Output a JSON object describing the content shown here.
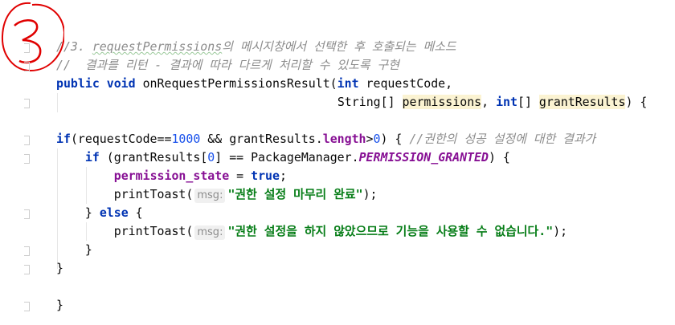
{
  "annotation": {
    "label": "3",
    "color": "#e00000"
  },
  "code_lines": [
    {
      "indent": 0,
      "tokens": [
        {
          "t": "//3. ",
          "c": "cm"
        },
        {
          "t": "requestPermissions",
          "c": "cm wavy"
        },
        {
          "t": "의 메시지창에서 선택한 후 호출되는 메소드",
          "c": "cm"
        }
      ]
    },
    {
      "indent": 0,
      "tokens": [
        {
          "t": "//  결과를 리턴 - 결과에 따라 다르게 처리할 수 있도록 구현",
          "c": "cm"
        }
      ]
    },
    {
      "indent": 0,
      "tokens": [
        {
          "t": "public void ",
          "c": "kw"
        },
        {
          "t": "onRequestPermissionsResult(",
          "c": ""
        },
        {
          "t": "int ",
          "c": "kw"
        },
        {
          "t": "requestCode,",
          "c": ""
        }
      ]
    },
    {
      "indent": 39,
      "tokens": [
        {
          "t": "String[] ",
          "c": ""
        },
        {
          "t": "permissions",
          "c": "hl"
        },
        {
          "t": ", ",
          "c": ""
        },
        {
          "t": "int",
          "c": "kw"
        },
        {
          "t": "[] ",
          "c": ""
        },
        {
          "t": "grantResults",
          "c": "hl"
        },
        {
          "t": ") {",
          "c": ""
        }
      ]
    },
    {
      "indent": 0,
      "tokens": []
    },
    {
      "indent": 0,
      "tokens": [
        {
          "t": "if",
          "c": "kw"
        },
        {
          "t": "(requestCode==",
          "c": ""
        },
        {
          "t": "1000",
          "c": "num"
        },
        {
          "t": " && grantResults.",
          "c": ""
        },
        {
          "t": "length",
          "c": "fld"
        },
        {
          "t": ">",
          "c": ""
        },
        {
          "t": "0",
          "c": "num"
        },
        {
          "t": ") { ",
          "c": ""
        },
        {
          "t": "//권한의 성공 설정에 대한 결과가",
          "c": "cm"
        }
      ]
    },
    {
      "indent": 4,
      "tokens": [
        {
          "t": "if ",
          "c": "kw"
        },
        {
          "t": "(grantResults[",
          "c": ""
        },
        {
          "t": "0",
          "c": "num"
        },
        {
          "t": "] == PackageManager.",
          "c": ""
        },
        {
          "t": "PERMISSION_GRANTED",
          "c": "cst"
        },
        {
          "t": ") {",
          "c": ""
        }
      ]
    },
    {
      "indent": 8,
      "tokens": [
        {
          "t": "permission_state",
          "c": "fld"
        },
        {
          "t": " = ",
          "c": ""
        },
        {
          "t": "true",
          "c": "kw"
        },
        {
          "t": ";",
          "c": ""
        }
      ]
    },
    {
      "indent": 8,
      "tokens": [
        {
          "t": "printToast(",
          "c": ""
        },
        {
          "t": "msg:",
          "c": "hint"
        },
        {
          "t": "\"권한 설정 마무리 완료\"",
          "c": "str"
        },
        {
          "t": ");",
          "c": ""
        }
      ]
    },
    {
      "indent": 4,
      "tokens": [
        {
          "t": "} ",
          "c": ""
        },
        {
          "t": "else",
          "c": "kw"
        },
        {
          "t": " {",
          "c": ""
        }
      ]
    },
    {
      "indent": 8,
      "tokens": [
        {
          "t": "printToast(",
          "c": ""
        },
        {
          "t": "msg:",
          "c": "hint"
        },
        {
          "t": "\"권한 설정을 하지 않았으므로 기능을 사용할 수 없습니다.\"",
          "c": "str"
        },
        {
          "t": ");",
          "c": ""
        }
      ]
    },
    {
      "indent": 4,
      "tokens": [
        {
          "t": "}",
          "c": ""
        }
      ]
    },
    {
      "indent": 0,
      "tokens": [
        {
          "t": "}",
          "c": ""
        }
      ]
    },
    {
      "indent": 0,
      "tokens": []
    },
    {
      "indent": 0,
      "tokens": [
        {
          "t": "}",
          "c": ""
        }
      ]
    }
  ],
  "gutter_marks": [
    0,
    1,
    3,
    5,
    6,
    9,
    11,
    12,
    14
  ]
}
